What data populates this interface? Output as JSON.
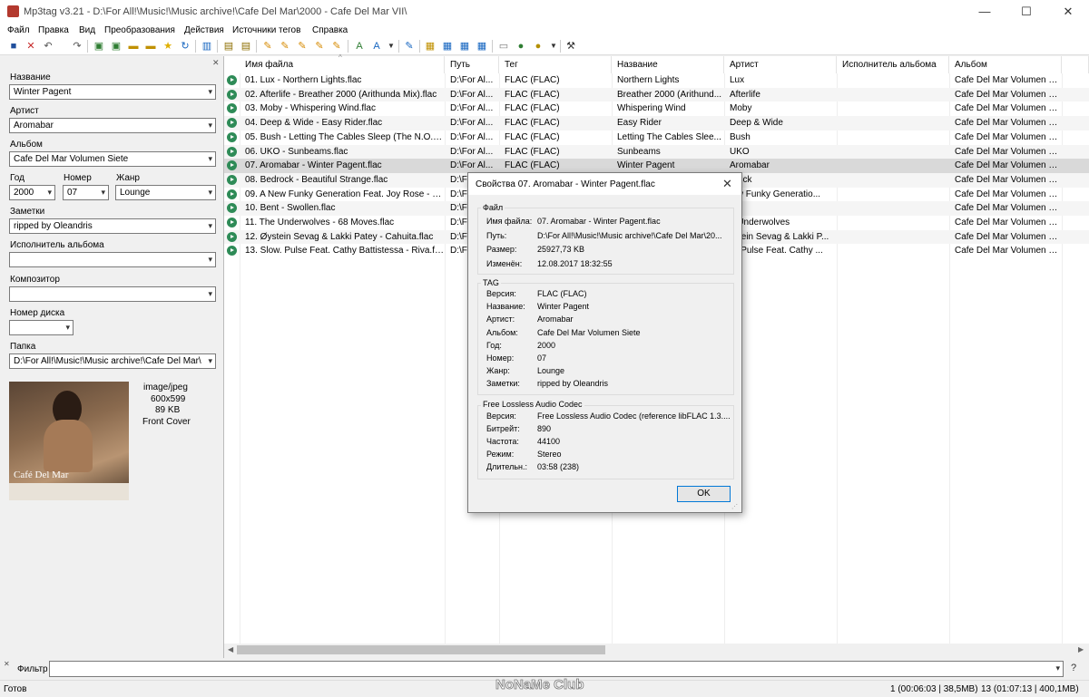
{
  "window": {
    "title": "Mp3tag v3.21  -  D:\\For All!\\Music!\\Music archive!\\Cafe Del Mar\\2000 - Cafe Del Mar VII\\",
    "minimize": "—",
    "maximize": "☐",
    "close": "✕"
  },
  "menu": [
    "Файл",
    "Правка",
    "Вид",
    "Преобразования",
    "Действия",
    "Источники тегов",
    "Справка"
  ],
  "left": {
    "title_label": "Название",
    "title_value": "Winter Pagent",
    "artist_label": "Артист",
    "artist_value": "Aromabar",
    "album_label": "Альбом",
    "album_value": "Cafe Del Mar Volumen Siete",
    "year_label": "Год",
    "year_value": "2000",
    "track_label": "Номер",
    "track_value": "07",
    "genre_label": "Жанр",
    "genre_value": "Lounge",
    "comment_label": "Заметки",
    "comment_value": "ripped by Oleandris",
    "albumartist_label": "Исполнитель альбома",
    "albumartist_value": "",
    "composer_label": "Композитор",
    "composer_value": "",
    "disc_label": "Номер диска",
    "disc_value": "",
    "folder_label": "Папка",
    "folder_value": "D:\\For All!\\Music!\\Music archive!\\Cafe Del Mar\\",
    "cover_mime": "image/jpeg",
    "cover_dims": "600x599",
    "cover_size": "89 KB",
    "cover_type": "Front Cover",
    "cover_text": "Café Del Mar"
  },
  "columns": [
    "Имя файла",
    "Путь",
    "Тег",
    "Название",
    "Артист",
    "Исполнитель альбома",
    "Альбом"
  ],
  "rows": [
    [
      "01. Lux - Northern Lights.flac",
      "D:\\For Al...",
      "FLAC (FLAC)",
      "Northern Lights",
      "Lux",
      "",
      "Cafe Del Mar Volumen S..."
    ],
    [
      "02. Afterlife - Breather 2000 (Arithunda Mix).flac",
      "D:\\For Al...",
      "FLAC (FLAC)",
      "Breather 2000 (Arithund...",
      "Afterlife",
      "",
      "Cafe Del Mar Volumen S..."
    ],
    [
      "03. Moby - Whispering Wind.flac",
      "D:\\For Al...",
      "FLAC (FLAC)",
      "Whispering Wind",
      "Moby",
      "",
      "Cafe Del Mar Volumen S..."
    ],
    [
      "04. Deep & Wide - Easy Rider.flac",
      "D:\\For Al...",
      "FLAC (FLAC)",
      "Easy Rider",
      "Deep & Wide",
      "",
      "Cafe Del Mar Volumen S..."
    ],
    [
      "05. Bush - Letting The Cables Sleep (The N.O.W....",
      "D:\\For Al...",
      "FLAC (FLAC)",
      "Letting The Cables Slee...",
      "Bush",
      "",
      "Cafe Del Mar Volumen S..."
    ],
    [
      "06. UKO - Sunbeams.flac",
      "D:\\For Al...",
      "FLAC (FLAC)",
      "Sunbeams",
      "UKO",
      "",
      "Cafe Del Mar Volumen S..."
    ],
    [
      "07. Aromabar - Winter Pagent.flac",
      "D:\\For Al...",
      "FLAC (FLAC)",
      "Winter Pagent",
      "Aromabar",
      "",
      "Cafe Del Mar Volumen S..."
    ],
    [
      "08. Bedrock - Beautiful Strange.flac",
      "D:\\For Al...",
      "",
      "",
      "drock",
      "",
      "Cafe Del Mar Volumen S..."
    ],
    [
      "09. A New Funky Generation Feat. Joy Rose - O...",
      "D:\\For Al...",
      "",
      "",
      "lew Funky Generatio...",
      "",
      "Cafe Del Mar Volumen S..."
    ],
    [
      "10. Bent - Swollen.flac",
      "D:\\For Al...",
      "",
      "",
      "nt",
      "",
      "Cafe Del Mar Volumen S..."
    ],
    [
      "11. The Underwolves - 68 Moves.flac",
      "D:\\For Al...",
      "",
      "",
      "e Underwolves",
      "",
      "Cafe Del Mar Volumen S..."
    ],
    [
      "12. Øystein Sevag & Lakki Patey - Cahuita.flac",
      "D:\\For Al...",
      "",
      "",
      "ystein Sevag & Lakki P...",
      "",
      "Cafe Del Mar Volumen S..."
    ],
    [
      "13. Slow. Pulse Feat. Cathy Battistessa - Riva.flac",
      "D:\\For Al...",
      "",
      "",
      "w. Pulse Feat. Cathy ...",
      "",
      "Cafe Del Mar Volumen S..."
    ]
  ],
  "dialog": {
    "title": "Свойства 07. Aromabar - Winter Pagent.flac",
    "file_group": "Файл",
    "file": [
      [
        "Имя файла:",
        "07. Aromabar - Winter Pagent.flac"
      ],
      [
        "Путь:",
        "D:\\For All!\\Music!\\Music archive!\\Cafe Del Mar\\20..."
      ],
      [
        "Размер:",
        "25927,73 KB"
      ],
      [
        "Изменён:",
        "12.08.2017 18:32:55"
      ]
    ],
    "tag_group": "TAG",
    "tag": [
      [
        "Версия:",
        "FLAC (FLAC)"
      ],
      [
        "Название:",
        "Winter Pagent"
      ],
      [
        "Артист:",
        "Aromabar"
      ],
      [
        "Альбом:",
        "Cafe Del Mar Volumen Siete"
      ],
      [
        "Год:",
        "2000"
      ],
      [
        "Номер:",
        "07"
      ],
      [
        "Жанр:",
        "Lounge"
      ],
      [
        "Заметки:",
        "ripped by Oleandris"
      ]
    ],
    "codec_group": "Free Lossless Audio Codec",
    "codec": [
      [
        "Версия:",
        "Free Lossless Audio Codec (reference libFLAC 1.3...."
      ],
      [
        "Битрейт:",
        "890"
      ],
      [
        "Частота:",
        "44100"
      ],
      [
        "Режим:",
        "Stereo"
      ],
      [
        "Длительн.:",
        "03:58 (238)"
      ]
    ],
    "ok": "OK"
  },
  "filter_label": "Фильтр",
  "status": {
    "left": "Готов",
    "watermark": "NoNaMe Club",
    "sel": "1 (00:06:03 | 38,5MB)",
    "total": "13 (01:07:13 | 400,1MB)"
  }
}
